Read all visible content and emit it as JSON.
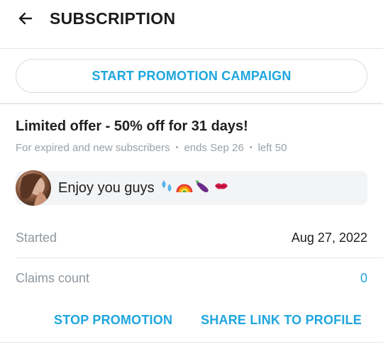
{
  "header": {
    "title": "SUBSCRIPTION",
    "back_icon": "arrow-left-icon"
  },
  "campaign": {
    "button_label": "START PROMOTION CAMPAIGN"
  },
  "offer": {
    "title": "Limited offer - 50% off for 31 days!",
    "audience": "For expired and new subscribers",
    "ends": "ends Sep 26",
    "left": "left 50"
  },
  "message": {
    "text": "Enjoy you guys",
    "emoji_names": [
      "sweat-droplets-icon",
      "rainbow-icon",
      "eggplant-icon",
      "kiss-mark-icon"
    ]
  },
  "details": {
    "started_label": "Started",
    "started_value": "Aug 27, 2022",
    "claims_label": "Claims count",
    "claims_value": "0"
  },
  "actions": {
    "stop_label": "STOP PROMOTION",
    "share_label": "SHARE LINK TO PROFILE"
  },
  "colors": {
    "accent": "#1ea6de",
    "muted_text": "#9aa1a7",
    "divider": "#e2e5e8"
  }
}
